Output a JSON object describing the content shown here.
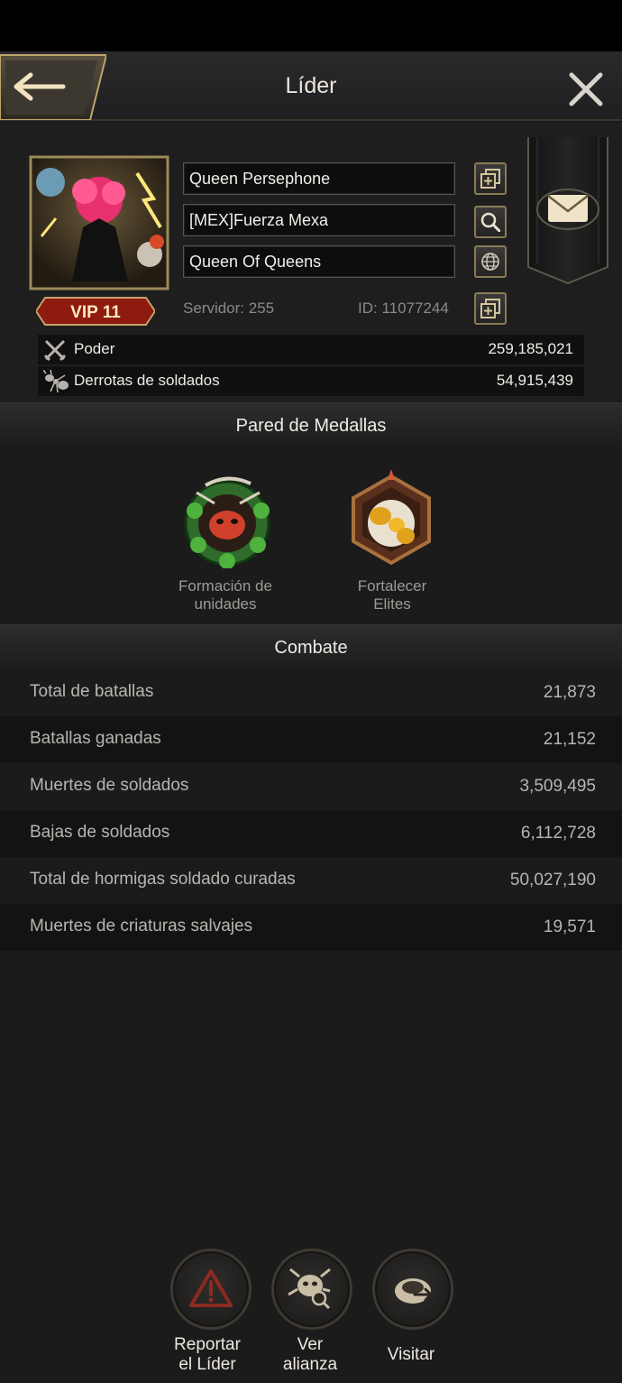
{
  "header": {
    "title": "Líder"
  },
  "profile": {
    "player_name": "Queen Persephone",
    "alliance_name": "[MEX]Fuerza Mexa",
    "title_name": "Queen Of Queens",
    "vip_label": "VIP 11",
    "server": "Servidor: 255",
    "player_id": "ID: 11077244",
    "stats": [
      {
        "label": "Poder",
        "value": "259,185,021",
        "icon": "crossed-swords-icon"
      },
      {
        "label": "Derrotas de soldados",
        "value": "54,915,439",
        "icon": "ant-icon"
      }
    ]
  },
  "medal_wall": {
    "title": "Pared de Medallas",
    "medals": [
      {
        "label_line1": "Formación de",
        "label_line2": "unidades",
        "icon": "clover-ant-medal-icon"
      },
      {
        "label_line1": "Fortalecer",
        "label_line2": "Elites",
        "icon": "golden-ant-medal-icon"
      }
    ]
  },
  "combat": {
    "title": "Combate",
    "rows": [
      {
        "label": "Total de batallas",
        "value": "21,873"
      },
      {
        "label": "Batallas ganadas",
        "value": "21,152"
      },
      {
        "label": "Muertes de soldados",
        "value": "3,509,495"
      },
      {
        "label": "Bajas de soldados",
        "value": "6,112,728"
      },
      {
        "label": "Total de hormigas soldado curadas",
        "value": "50,027,190"
      },
      {
        "label": "Muertes de criaturas salvajes",
        "value": "19,571"
      }
    ]
  },
  "actions": [
    {
      "line1": "Reportar",
      "line2": "el Líder",
      "icon": "warning-icon"
    },
    {
      "line1": "Ver",
      "line2": "alianza",
      "icon": "alliance-search-icon"
    },
    {
      "line1": "Visitar",
      "line2": "",
      "icon": "visit-icon"
    }
  ],
  "colors": {
    "accent_gold": "#8a7a55",
    "vip_red": "#8e1a10",
    "background": "#1b1b1b"
  }
}
